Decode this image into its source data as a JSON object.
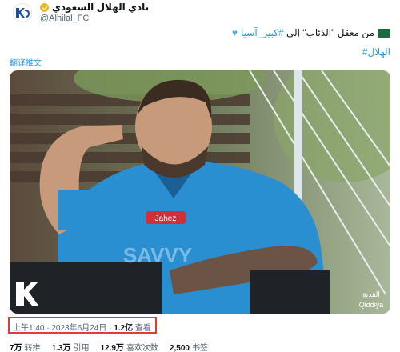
{
  "account": {
    "display_name": "نادي الهلال السعودي",
    "handle": "@Alhilal_FC"
  },
  "tweet": {
    "text_prefix": "من معقل \"الذئاب\" إلى ",
    "hashtag1": "#كبير_آسيا",
    "hashtag2": "#الهلال",
    "translate_label": "翻译推文"
  },
  "media": {
    "jersey_sponsor": "Jahez",
    "jersey_text": "SAVVY",
    "watermark_text": "Qiddiya",
    "watermark_arabic": "القدية"
  },
  "meta": {
    "time": "上午1:40",
    "date": "2023年6月24日",
    "views_count": "1.2亿",
    "views_label": "查看"
  },
  "stats": [
    {
      "count": "7万",
      "label": "转推"
    },
    {
      "count": "1.3万",
      "label": "引用"
    },
    {
      "count": "12.9万",
      "label": "喜欢次数"
    },
    {
      "count": "2,500",
      "label": "书签"
    }
  ],
  "colors": {
    "link": "#1d9bf0",
    "highlight_border": "#e53935",
    "jersey": "#2a8fd0"
  }
}
